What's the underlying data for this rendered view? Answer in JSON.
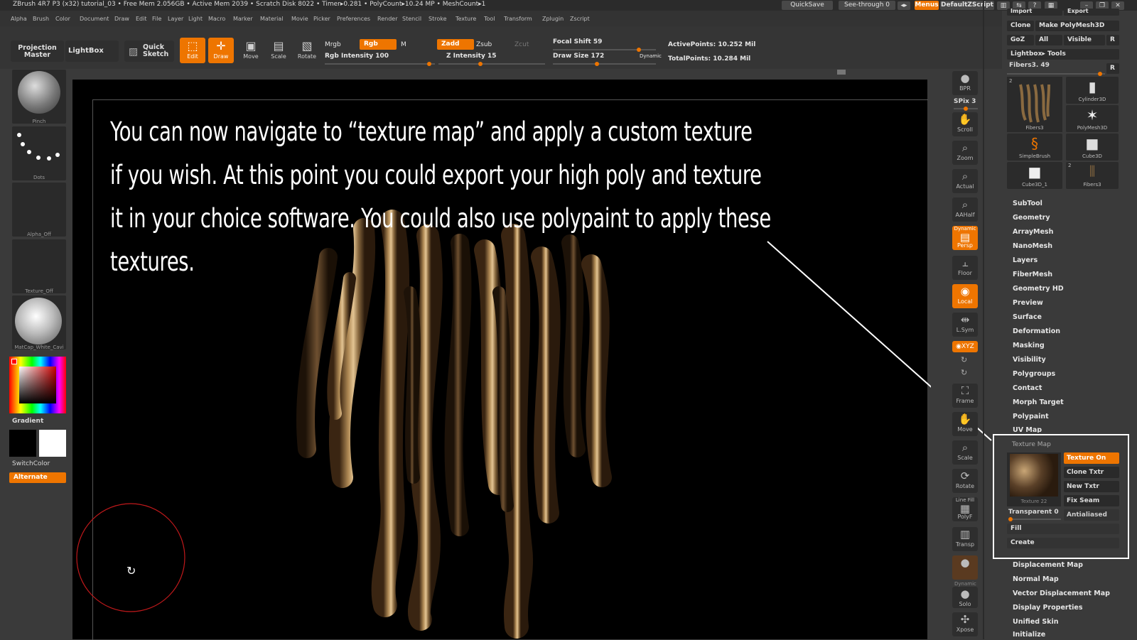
{
  "titlebar": {
    "title": "ZBrush 4R7 P3 (x32)   tutorial_03    • Free Mem 2.056GB • Active Mem 2039 • Scratch Disk 8022 •   Timer▸0.281 • PolyCount▸10.24 MP  • MeshCount▸1",
    "quicksave": "QuickSave",
    "seethrough": "See-through  0",
    "menus": "Menus",
    "script": "DefaultZScript"
  },
  "menubar": [
    "Alpha",
    "Brush",
    "Color",
    "Document",
    "Draw",
    "Edit",
    "File",
    "Layer",
    "Light",
    "Macro",
    "Marker",
    "Material",
    "Movie",
    "Picker",
    "Preferences",
    "Render",
    "Stencil",
    "Stroke",
    "Texture",
    "Tool",
    "Transform",
    "Zplugin",
    "Zscript"
  ],
  "shelf": {
    "projection_master": "Projection Master",
    "lightbox": "LightBox",
    "quick_sketch": "Quick Sketch",
    "edit": "Edit",
    "draw": "Draw",
    "move": "Move",
    "scale": "Scale",
    "rotate": "Rotate",
    "mrgb": "Mrgb",
    "rgb": "Rgb",
    "m": "M",
    "zadd": "Zadd",
    "zsub": "Zsub",
    "zcut": "Zcut",
    "rgb_intensity": "Rgb Intensity 100",
    "z_intensity": "Z Intensity 15",
    "focal_shift": "Focal Shift 59",
    "draw_size": "Draw Size 172",
    "dynamic": "Dynamic",
    "active_points": "ActivePoints: 10.252  Mil",
    "total_points": "TotalPoints: 10.284  Mil"
  },
  "lefttray": {
    "brush": "Pinch",
    "stroke": "Dots",
    "alpha": "Alpha_Off",
    "texture": "Texture_Off",
    "material": "MatCap_White_Cavi",
    "gradient": "Gradient",
    "switchcolor": "SwitchColor",
    "alternate": "Alternate"
  },
  "caption": {
    "line1": "You can now navigate to “texture map” and apply a custom texture",
    "line2": "if you wish. At this point you could export your high poly and texture",
    "line3": "it in your choice software. You could also use polypaint to apply these",
    "line4": "textures."
  },
  "rightshelf": {
    "bpr": "BPR",
    "spix": "SPix 3",
    "scroll": "Scroll",
    "zoom": "Zoom",
    "actual": "Actual",
    "aahalf": "AAHalf",
    "persp": "Persp",
    "persp_top": "Dynamic",
    "floor": "Floor",
    "local": "Local",
    "lsym": "L.Sym",
    "xyz": "◉XYZ",
    "frame": "Frame",
    "move": "Move",
    "scale": "Scale",
    "rotate": "Rotate",
    "polyf": "PolyF",
    "linefill": "Line Fill",
    "transp": "Transp",
    "ghost": "Dynamic",
    "solo": "Solo",
    "xpose": "Xpose"
  },
  "palette": {
    "import": "Import",
    "export": "Export",
    "clone": "Clone",
    "make_polymesh": "Make PolyMesh3D",
    "goz": "GoZ",
    "all": "All",
    "visible": "Visible",
    "r": "R",
    "lightbox_tools": "Lightbox▸ Tools",
    "current_tool": "Fibers3. 49",
    "tools": [
      {
        "name": "Fibers3",
        "count": "2"
      },
      {
        "name": "Cylinder3D",
        "count": ""
      },
      {
        "name": "PolyMesh3D",
        "count": ""
      },
      {
        "name": "SimpleBrush",
        "count": ""
      },
      {
        "name": "Cube3D",
        "count": ""
      },
      {
        "name": "Cube3D_1",
        "count": ""
      },
      {
        "name": "Fibers3",
        "count": "2"
      }
    ],
    "subpalettes_top": [
      "SubTool",
      "Geometry",
      "ArrayMesh",
      "NanoMesh",
      "Layers",
      "FiberMesh",
      "Geometry HD",
      "Preview",
      "Surface",
      "Deformation",
      "Masking",
      "Visibility",
      "Polygroups",
      "Contact",
      "Morph Target",
      "Polypaint",
      "UV Map"
    ],
    "texture_map": {
      "title": "Texture Map",
      "thumb": "Texture 22",
      "texture_on": "Texture On",
      "clone_txtr": "Clone Txtr",
      "new_txtr": "New Txtr",
      "fix_seam": "Fix Seam",
      "transparent": "Transparent 0",
      "antialiased": "Antialiased",
      "fill": "Fill",
      "create": "Create"
    },
    "subpalettes_bottom": [
      "Displacement Map",
      "Normal Map",
      "Vector Displacement Map",
      "Display Properties",
      "Unified Skin",
      "Initialize"
    ]
  },
  "colors": {
    "accent": "#ee7500",
    "highlight_box": "#ffffff",
    "cursor_ring": "#c0191b"
  }
}
